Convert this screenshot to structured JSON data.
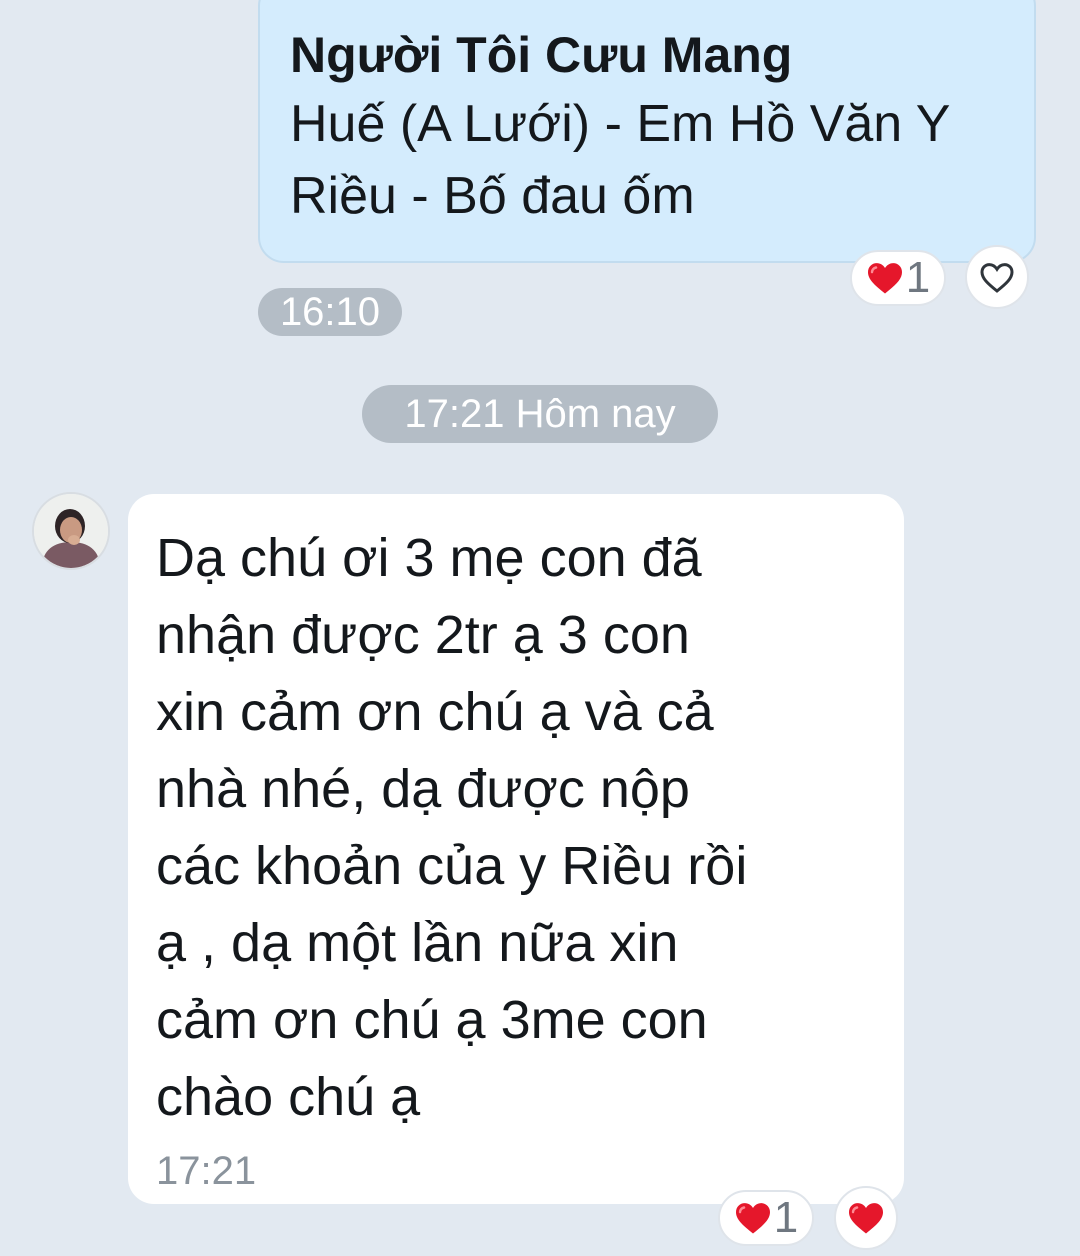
{
  "outgoing_message": {
    "title": "Người Tôi Cưu Mang",
    "lines": [
      "Huế (A Lưới) - Em Hồ Văn Y",
      "Riều - Bố đau ốm"
    ],
    "reaction_count": "1",
    "time": "16:10"
  },
  "date_separator": "17:21 Hôm nay",
  "incoming_message": {
    "lines": [
      "Dạ chú ơi 3 mẹ con đã",
      "nhận được 2tr ạ 3 con",
      "xin cảm ơn chú ạ và cả",
      "nhà nhé, dạ được nộp",
      "các khoản của y Riều rồi",
      "ạ , dạ một lần nữa xin",
      "cảm ơn chú ạ 3me con",
      "chào chú ạ"
    ],
    "time": "17:21",
    "reaction_count": "1"
  },
  "icons": {
    "reaction": "heart-icon",
    "react_button": "heart-outline-icon"
  },
  "colors": {
    "background": "#e2e9f1",
    "outgoing_bubble": "#d4ecfd",
    "incoming_bubble": "#ffffff",
    "heart": "#e5172b",
    "time_chip": "#b4bdc6"
  }
}
